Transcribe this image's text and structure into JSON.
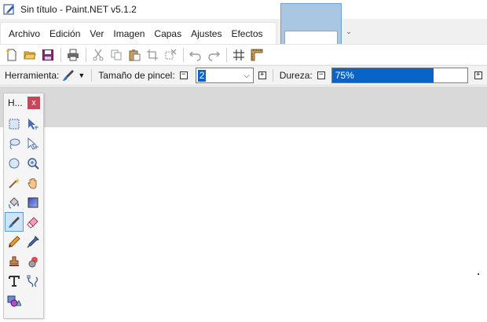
{
  "window": {
    "title": "Sin título - Paint.NET v5.1.2"
  },
  "menu": {
    "items": [
      "Archivo",
      "Edición",
      "Ver",
      "Imagen",
      "Capas",
      "Ajustes",
      "Efectos"
    ]
  },
  "toolbar": {
    "icons": [
      "new-file-icon",
      "open-folder-icon",
      "save-icon",
      "print-icon",
      "cut-icon",
      "copy-icon",
      "paste-icon",
      "crop-icon",
      "deselect-icon",
      "undo-icon",
      "redo-icon",
      "grid-icon",
      "ruler-icon"
    ]
  },
  "options": {
    "tool_label": "Herramienta:",
    "brush_size_label": "Tamaño de pincel:",
    "brush_size_value": "2",
    "hardness_label": "Dureza:",
    "hardness_value": "75%",
    "hardness_fraction": 0.75
  },
  "tools_panel": {
    "title": "H...",
    "close_label": "x",
    "tools": [
      "rectangle-select-icon",
      "move-selection-icon",
      "lasso-select-icon",
      "move-selected-icon",
      "ellipse-select-icon",
      "zoom-icon",
      "magic-wand-icon",
      "pan-icon",
      "paint-bucket-icon",
      "gradient-icon",
      "paintbrush-icon",
      "eraser-icon",
      "pencil-icon",
      "color-picker-icon",
      "clone-stamp-icon",
      "recolor-icon",
      "text-icon",
      "line-curve-icon",
      "shapes-icon"
    ],
    "active_tool": "paintbrush-icon"
  },
  "colors": {
    "accent": "#0a64c8",
    "close_button": "#c8465a",
    "thumbnail_bg": "#a9c7e2"
  }
}
